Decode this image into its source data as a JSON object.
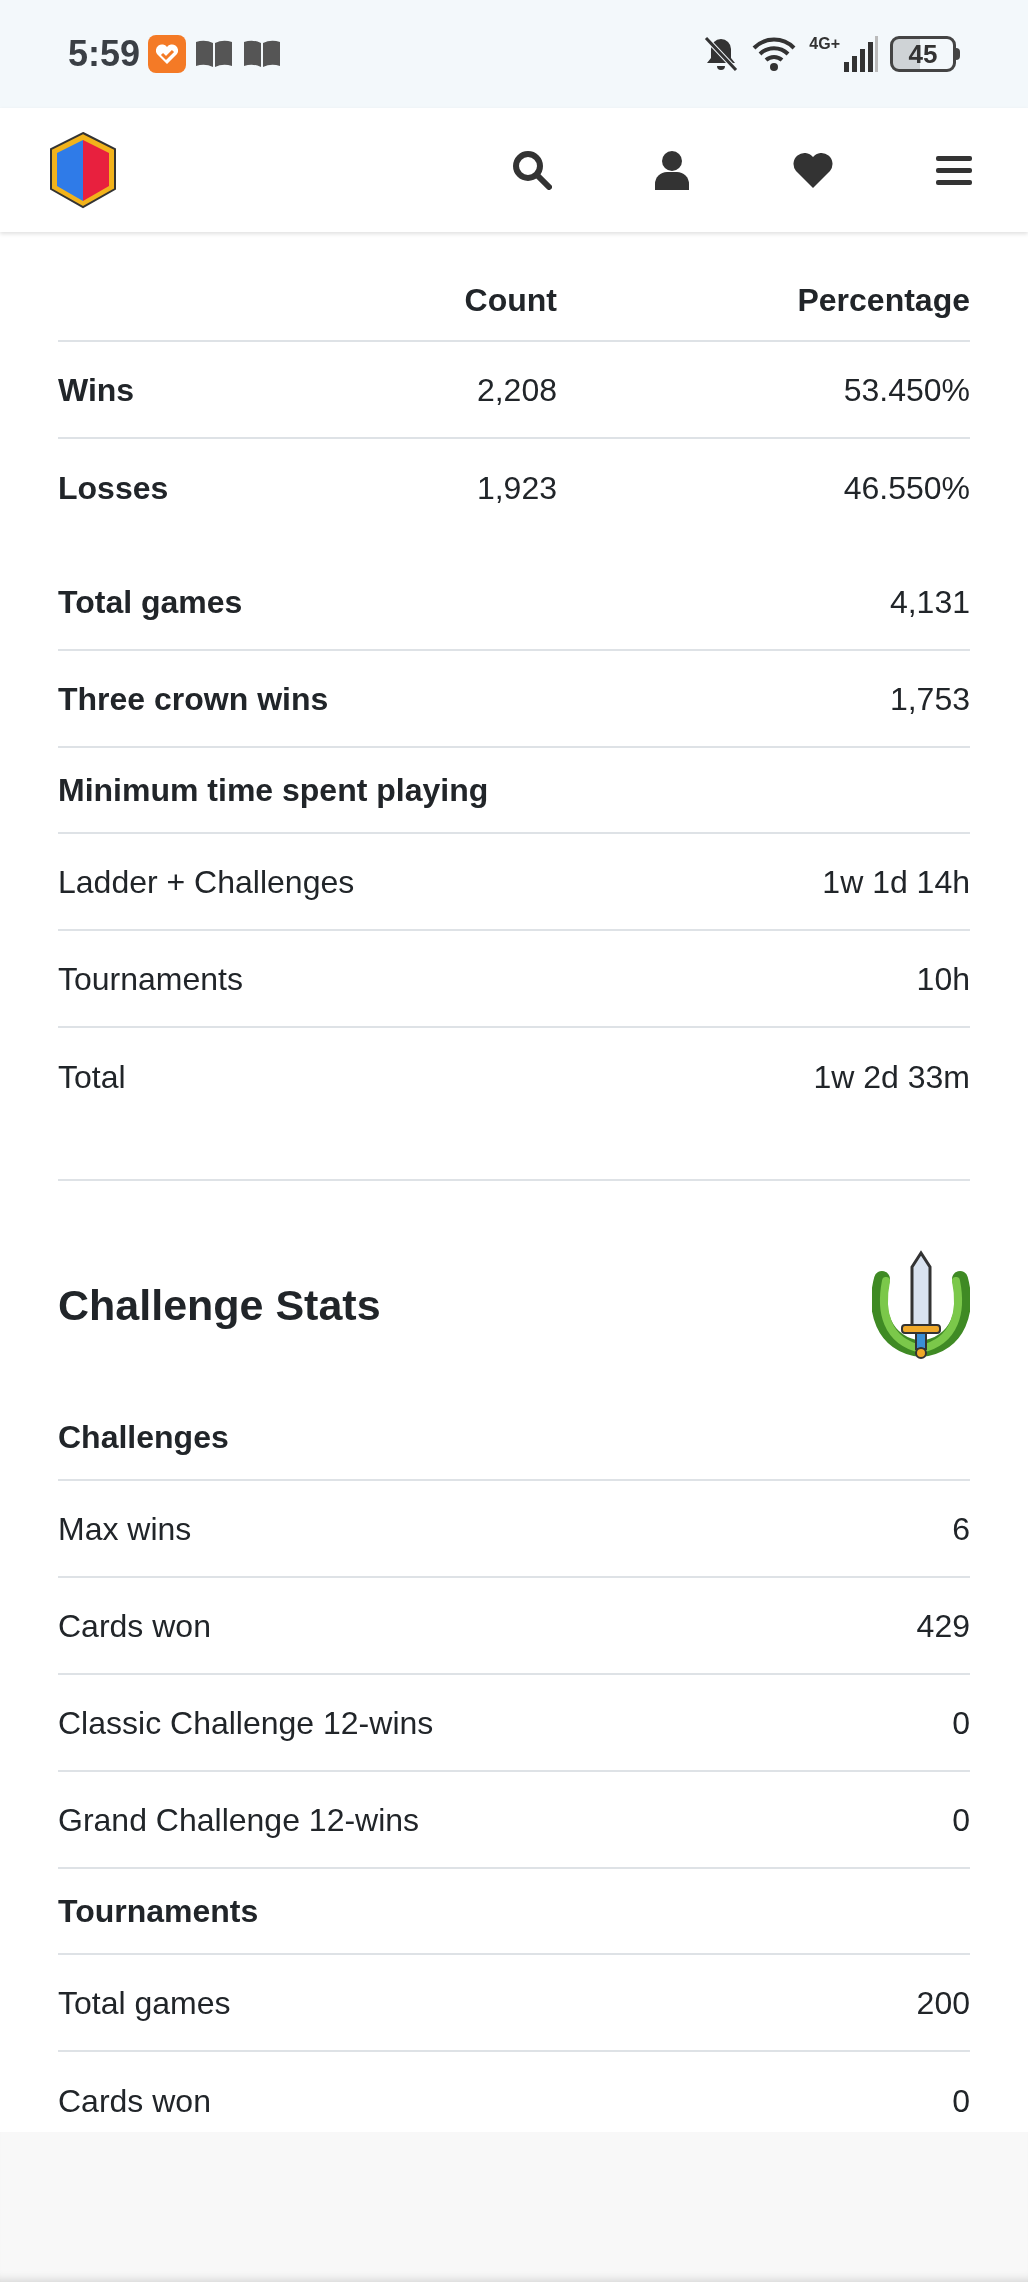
{
  "status_bar": {
    "time": "5:59",
    "network": "4G+",
    "battery": "45"
  },
  "outcome_table": {
    "columns": [
      "Count",
      "Percentage"
    ],
    "rows": [
      {
        "label": "Wins",
        "count": "2,208",
        "percentage": "53.450%"
      },
      {
        "label": "Losses",
        "count": "1,923",
        "percentage": "46.550%"
      }
    ]
  },
  "summary_rows": [
    {
      "kind": "bold",
      "label": "Total games",
      "value": "4,131"
    },
    {
      "kind": "bold",
      "label": "Three crown wins",
      "value": "1,753"
    },
    {
      "kind": "section",
      "label": "Minimum time spent playing"
    },
    {
      "kind": "plain",
      "label": "Ladder + Challenges",
      "value": "1w 1d 14h"
    },
    {
      "kind": "plain",
      "label": "Tournaments",
      "value": "10h"
    },
    {
      "kind": "plain",
      "label": "Total",
      "value": "1w 2d 33m"
    }
  ],
  "challenge_stats": {
    "title": "Challenge Stats",
    "rows": [
      {
        "kind": "section",
        "label": "Challenges"
      },
      {
        "kind": "plain",
        "label": "Max wins",
        "value": "6"
      },
      {
        "kind": "plain",
        "label": "Cards won",
        "value": "429"
      },
      {
        "kind": "plain",
        "label": "Classic Challenge 12-wins",
        "value": "0"
      },
      {
        "kind": "plain",
        "label": "Grand Challenge 12-wins",
        "value": "0"
      },
      {
        "kind": "section",
        "label": "Tournaments"
      },
      {
        "kind": "plain",
        "label": "Total games",
        "value": "200"
      },
      {
        "kind": "plain",
        "label": "Cards won",
        "value": "0"
      }
    ]
  }
}
